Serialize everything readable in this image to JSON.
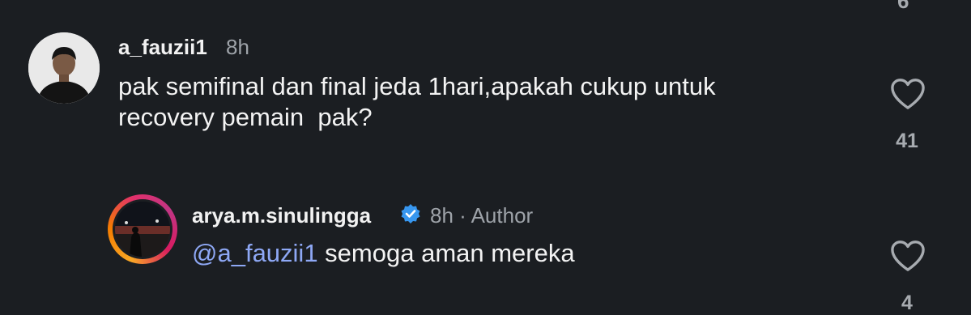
{
  "top_cut_count": "6",
  "comment1": {
    "username": "a_fauzii1",
    "time": "8h",
    "text_line1": "pak semifinal dan final jeda 1hari,apakah cukup untuk",
    "text_line2": "recovery pemain  pak?",
    "likes": "41"
  },
  "reply1": {
    "username": "arya.m.sinulingga",
    "time": "8h · Author",
    "mention": "@a_fauzii1",
    "text": " semoga aman mereka",
    "likes": "4"
  },
  "colors": {
    "background": "#1b1e22",
    "mention": "#8ea8f5",
    "verified": "#3797f0",
    "meta": "#9ea3a9"
  }
}
